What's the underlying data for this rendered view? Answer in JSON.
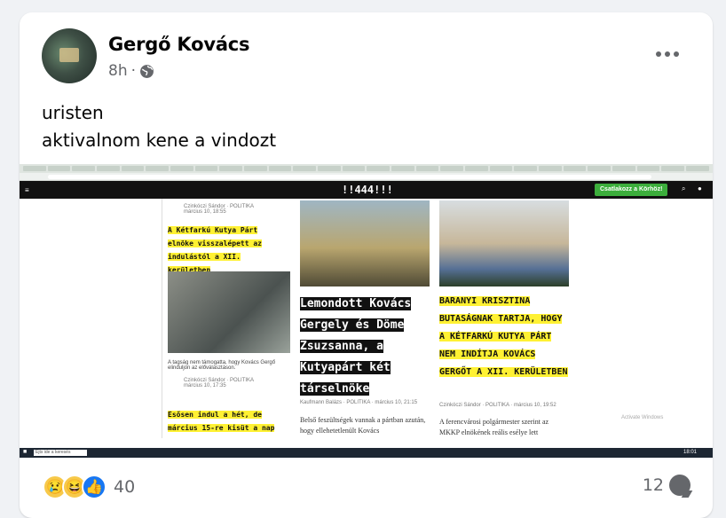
{
  "post": {
    "author": "Gergő Kovács",
    "time": "8h",
    "separator": "·",
    "text_line1": "uristen",
    "text_line2": "aktivalnom kene a vindozt"
  },
  "screenshot": {
    "site_logo": "!!444!!!",
    "join_button": "Csatlakozz a Körhöz!",
    "col1": {
      "author": "Czinkóczi Sándor",
      "section": "POLITIKA",
      "date": "március 10, 18:55",
      "headline1": "A Kétfarkú Kutya Párt elnöke visszalépett az indulástól a XII. kerületben",
      "caption": "A tagság nem támogatta, hogy Kovács Gergő elinduljon az előválasztáson.",
      "author2": "Czinkóczi Sándor",
      "section2": "POLITIKA",
      "date2": "március 10, 17:35",
      "headline2": "Esősen indul a hét, de március 15-re kisüt a nap"
    },
    "col2": {
      "headline": "Lemondott Kovács Gergely és Döme Zsuzsanna, a Kutyapárt két társelnöke",
      "byline": "Kaufmann Balázs · POLITIKA · március 10, 21:15",
      "lead": "Belső feszültségek vannak a pártban azután, hogy ellehetetlenült Kovács"
    },
    "col3": {
      "headline": "BARANYI KRISZTINA BUTASÁGNAK TARTJA, HOGY A KÉTFARKÚ KUTYA PÁRT NEM INDÍTJA KOVÁCS GERGŐT A XII. KERÜLETBEN",
      "byline": "Czinkóczi Sándor · POLITIKA · március 10, 19:52",
      "lead": "A ferencvárosi polgármester szerint az MKKP elnökének reális esélye lett",
      "watermark": "Activate Windows"
    },
    "taskbar": {
      "search": "Ejts ide a keresés",
      "clock": "18:01"
    }
  },
  "reactions": {
    "count": "40",
    "icons": [
      "sad",
      "haha",
      "like"
    ],
    "comments": "12"
  },
  "colors": {
    "highlight": "#fff133",
    "fb_gray": "#65676b",
    "like_blue": "#1877f2"
  }
}
